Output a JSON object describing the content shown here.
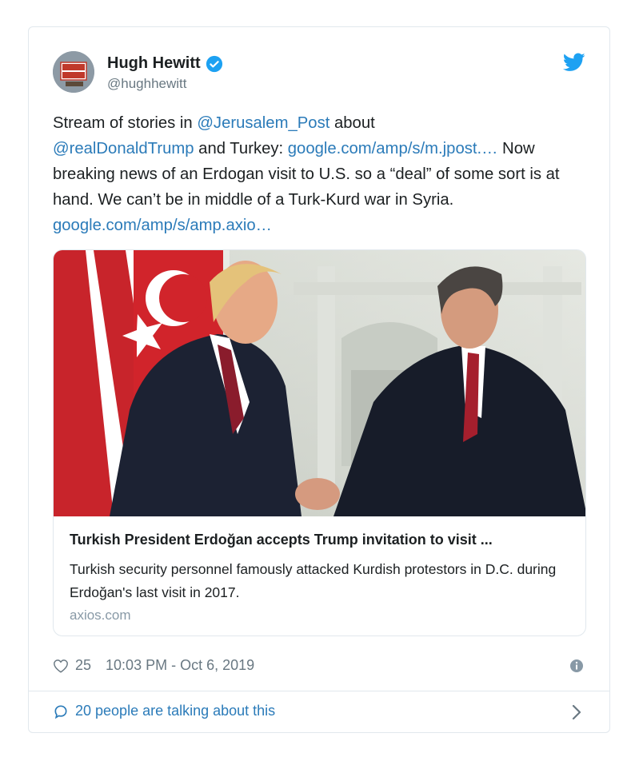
{
  "tweet": {
    "author": {
      "name": "Hugh Hewitt",
      "handle": "@hughhewitt",
      "avatar_text": "HUGH HEWITT"
    },
    "text": {
      "p1": "Stream of stories in ",
      "link_jpost_mention": "@Jerusalem_Post",
      "p2": " about ",
      "link_trump_mention": "@realDonaldTrump",
      "p3": " and Turkey: ",
      "link_jpost_url": "google.com/amp/s/m.jpost.…",
      "p4": " Now breaking news of an Erdogan visit to U.S. so a “deal” of some sort is at hand. We can’t be in middle of a Turk-Kurd war in Syria. ",
      "link_axios_url": "google.com/amp/s/amp.axio…"
    },
    "card": {
      "title": "Turkish President Erdoğan accepts Trump invitation to visit ...",
      "description": "Turkish security personnel famously attacked Kurdish protestors in D.C. during Erdoğan's last visit in 2017.",
      "domain": "axios.com"
    },
    "likes": "25",
    "timestamp": "10:03 PM - Oct 6, 2019",
    "talking": "20 people are talking about this"
  },
  "icons": {
    "verified": "verified-badge-icon",
    "bird": "twitter-bird-icon",
    "heart": "heart-icon",
    "info": "info-icon",
    "bubble": "comment-bubble-icon",
    "chevron": "chevron-right-icon"
  },
  "colors": {
    "link": "#2b7bb9",
    "brand": "#1da1f2",
    "muted": "#697882",
    "border": "#e1e8ed"
  }
}
